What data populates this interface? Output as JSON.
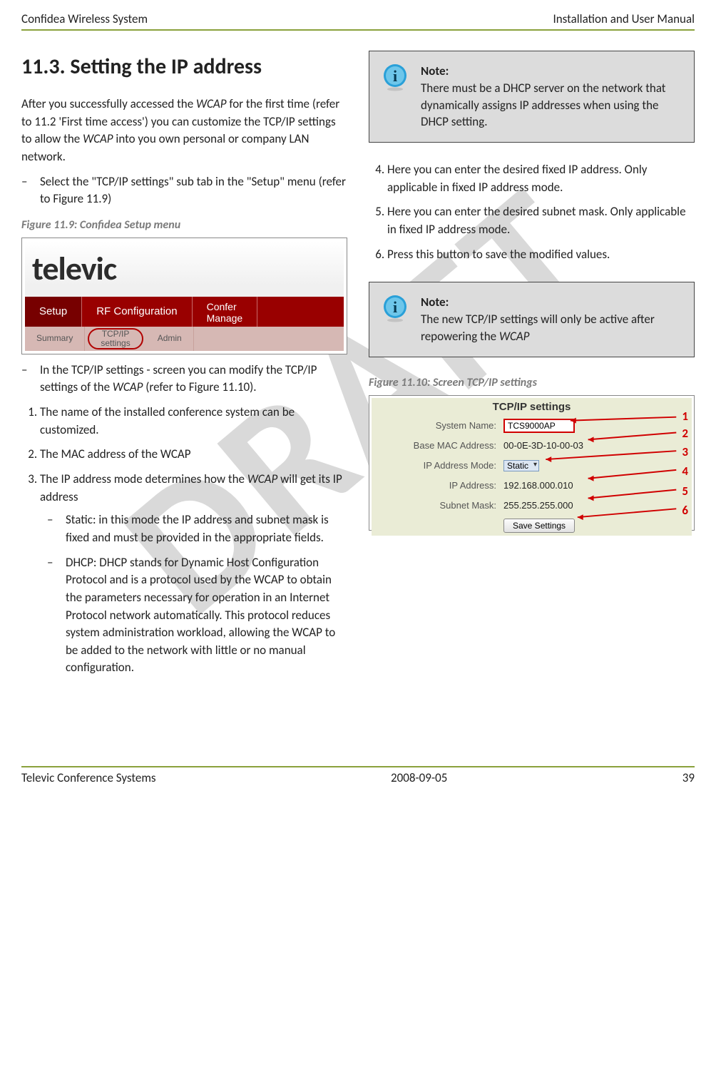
{
  "header": {
    "left": "Confidea Wireless System",
    "right": "Installation and User Manual"
  },
  "section": {
    "title": "11.3.  Setting the IP address",
    "intro_pre": "After you successfully accessed the ",
    "intro_em": "WCAP",
    "intro_mid": " for the first time (refer to 11.2 'First time access') you can customize the TCP/IP settings to allow the ",
    "intro_em2": "WCAP",
    "intro_post": " into you own personal or company LAN network.",
    "bullet1": "Select the \"TCP/IP settings\" sub tab in the \"Setup\" menu (refer to Figure 11.9)",
    "fig9_caption": "Figure 11.9: Confidea Setup menu",
    "bullet2_pre": "In the TCP/IP settings - screen you can modify the TCP/IP settings of the ",
    "bullet2_em": "WCAP",
    "bullet2_post": " (refer to Figure 11.10).",
    "ol1": "The name of the installed conference system can be customized.",
    "ol2": "The MAC address of the WCAP",
    "ol3_pre": "The IP address mode determines how the ",
    "ol3_em": "WCAP",
    "ol3_post": " will get its IP address",
    "ol3_a": "Static: in this mode the IP address and subnet mask is fixed and must be provided in the appropriate fields.",
    "ol3_b": "DHCP: DHCP stands for Dynamic Host Configuration Protocol and is a protocol used by the WCAP to obtain the parameters necessary for operation in an Internet Protocol network automatically. This protocol reduces system administration workload, allowing the WCAP to be added to the network with little or no manual configuration."
  },
  "note1": {
    "label": "Note:",
    "text": "There must be a DHCP server on the network that dynamically assigns IP addresses when using the DHCP setting."
  },
  "ol_right": {
    "i4": "Here you can enter the desired fixed IP address. Only applicable in fixed IP address mode.",
    "i5": "Here you can enter the desired subnet mask. Only applicable in fixed IP address mode.",
    "i6": "Press this button to save the modified values."
  },
  "note2": {
    "label": "Note:",
    "text_pre": "The new TCP/IP settings will only be active after repowering the ",
    "text_em": "WCAP"
  },
  "fig10_caption": "Figure 11.10: Screen TCP/IP settings",
  "setup_menu": {
    "logo": "televic",
    "tab_setup": "Setup",
    "tab_rf": "RF Configuration",
    "tab_conf": "Confer\nManage",
    "sub_summary": "Summary",
    "sub_tcp": "TCP/IP\nsettings",
    "sub_admin": "Admin"
  },
  "tcp": {
    "title": "TCP/IP settings",
    "labels": {
      "sys": "System Name:",
      "mac": "Base MAC Address:",
      "mode": "IP Address Mode:",
      "ip": "IP Address:",
      "mask": "Subnet Mask:"
    },
    "values": {
      "sys": "TCS9000AP",
      "mac": "00-0E-3D-10-00-03",
      "mode": "Static",
      "ip": "192.168.000.010",
      "mask": "255.255.255.000"
    },
    "button": "Save Settings",
    "callouts": [
      "1",
      "2",
      "3",
      "4",
      "5",
      "6"
    ]
  },
  "footer": {
    "left": "Televic Conference Systems",
    "center": "2008-09-05",
    "right": "39"
  }
}
